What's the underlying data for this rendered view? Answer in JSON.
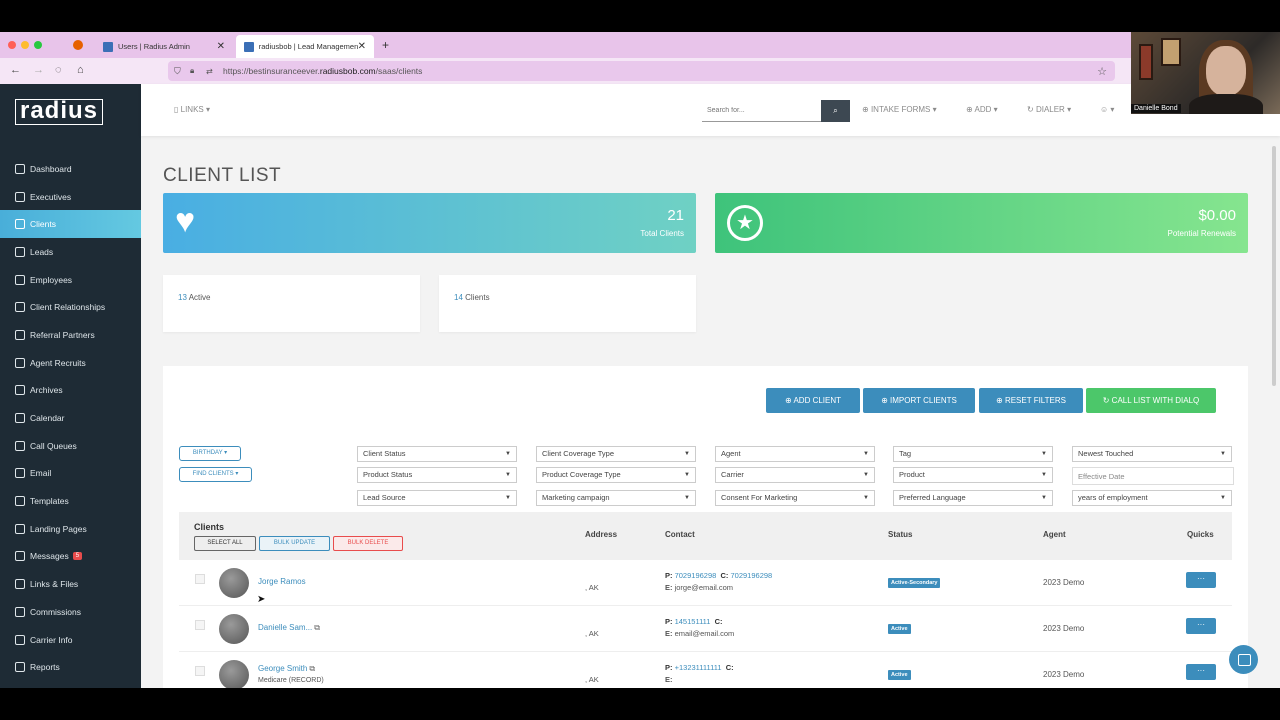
{
  "browser": {
    "tabs": [
      {
        "label": "Users | Radius Admin",
        "active": false
      },
      {
        "label": "radiusbob | Lead Management",
        "active": true
      }
    ],
    "url_prefix": "https://bestinsuranceever.",
    "url_domain": "radiusbob.com",
    "url_path": "/saas/clients"
  },
  "sidebar": {
    "logo": "radius",
    "items": [
      {
        "label": "Dashboard"
      },
      {
        "label": "Executives"
      },
      {
        "label": "Clients",
        "active": true
      },
      {
        "label": "Leads"
      },
      {
        "label": "Employees"
      },
      {
        "label": "Client Relationships"
      },
      {
        "label": "Referral Partners"
      },
      {
        "label": "Agent Recruits"
      },
      {
        "label": "Archives"
      },
      {
        "label": "Calendar"
      },
      {
        "label": "Call Queues"
      },
      {
        "label": "Email"
      },
      {
        "label": "Templates"
      },
      {
        "label": "Landing Pages"
      },
      {
        "label": "Messages",
        "badge": "5"
      },
      {
        "label": "Links & Files"
      },
      {
        "label": "Commissions"
      },
      {
        "label": "Carrier Info"
      },
      {
        "label": "Reports"
      }
    ]
  },
  "topbar": {
    "links": "LINKS",
    "search_placeholder": "Search for...",
    "intake_forms": "INTAKE FORMS",
    "add": "ADD",
    "dialer": "DIALER"
  },
  "page": {
    "title": "CLIENT LIST",
    "total_clients_value": "21",
    "total_clients_label": "Total Clients",
    "renewals_value": "$0.00",
    "renewals_label": "Potential Renewals",
    "active_count": "13",
    "active_label": "Active",
    "clients_count": "14",
    "clients_label": "Clients"
  },
  "actions": {
    "add_client": "ADD CLIENT",
    "import_clients": "IMPORT CLIENTS",
    "reset_filters": "RESET FILTERS",
    "call_list": "CALL LIST WITH DIALQ"
  },
  "filters": {
    "birthday": "BIRTHDAY",
    "find_clients": "FIND CLIENTS",
    "selects": [
      "Client Status",
      "Client Coverage Type",
      "Agent",
      "Tag",
      "Newest Touched",
      "Product Status",
      "Product Coverage Type",
      "Carrier",
      "Product",
      "Lead Source",
      "Marketing campaign",
      "Consent For Marketing",
      "Preferred Language",
      "years of employment"
    ],
    "effective_date_placeholder": "Effective Date"
  },
  "table": {
    "title": "Clients",
    "select_all": "SELECT ALL",
    "bulk_update": "BULK UPDATE",
    "bulk_delete": "BULK DELETE",
    "columns": {
      "address": "Address",
      "contact": "Contact",
      "status": "Status",
      "agent": "Agent",
      "quicks": "Quicks"
    },
    "rows": [
      {
        "name": "Jorge Ramos",
        "sub": "",
        "address": ", AK",
        "phone": "7029196298",
        "cell": "7029196298",
        "email": "jorge@email.com",
        "status": "Active-Secondary",
        "agent": "2023 Demo"
      },
      {
        "name": "Danielle Sam...",
        "sub": "",
        "address": ", AK",
        "phone": "145151111",
        "cell": "",
        "email": "email@email.com",
        "status": "Active",
        "agent": "2023 Demo"
      },
      {
        "name": "George Smith",
        "sub": "Medicare (RECORD)",
        "address": ", AK",
        "phone": "+13231111111",
        "cell": "",
        "email": "",
        "status": "Active",
        "agent": "2023 Demo"
      }
    ]
  },
  "video": {
    "name": "Danielle Bond"
  },
  "colors": {
    "sidebar": "#1e2b35",
    "accent": "#3c8dbc",
    "green": "#4cc76a"
  }
}
